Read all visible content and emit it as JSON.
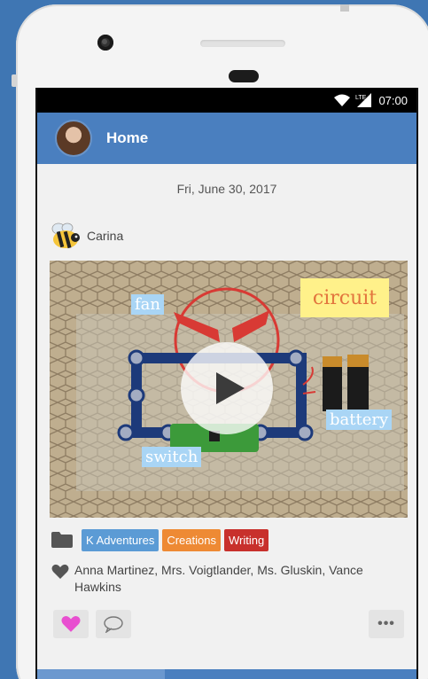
{
  "status_bar": {
    "time": "07:00",
    "network": "LTE",
    "icons": [
      "wifi-icon",
      "signal-icon"
    ]
  },
  "app_bar": {
    "title": "Home"
  },
  "feed": {
    "date": "Fri, June 30, 2017",
    "post": {
      "author": "Carina",
      "author_icon": "bee-icon",
      "media": {
        "labels": {
          "fan": "fan",
          "circuit": "circuit",
          "battery": "battery",
          "switch": "switch"
        }
      },
      "tags": [
        {
          "label": "K Adventures",
          "color": "#5b9bd5"
        },
        {
          "label": "Creations",
          "color": "#ee8a34"
        },
        {
          "label": "Writing",
          "color": "#c8302c"
        }
      ],
      "likes": "Anna Martinez, Mrs. Voigtlander, Ms. Gluskin, Vance Hawkins",
      "actions": {
        "more": "•••"
      }
    }
  },
  "colors": {
    "app_bar": "#4a7fbf",
    "background": "#3f76b3",
    "like_heart": "#e84fd0"
  }
}
